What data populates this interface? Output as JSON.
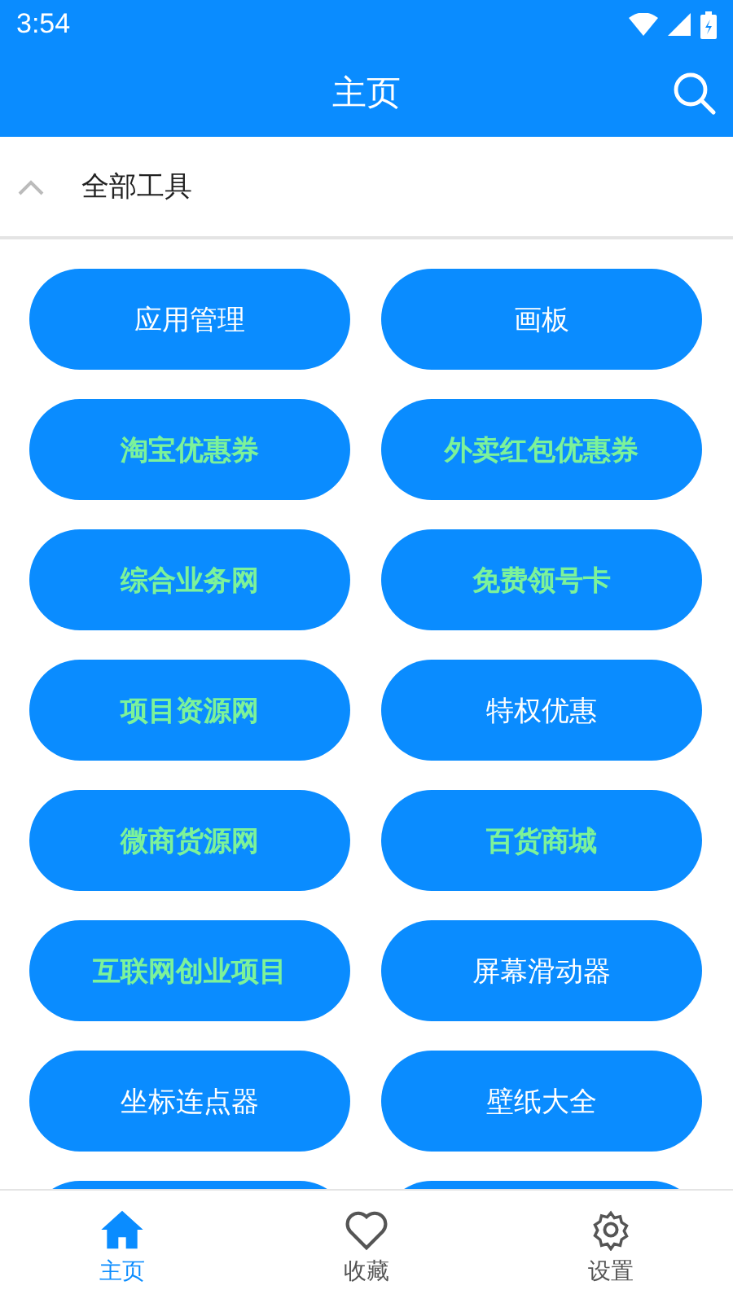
{
  "status_bar": {
    "time": "3:54"
  },
  "app_bar": {
    "title": "主页"
  },
  "section": {
    "title": "全部工具",
    "expanded": true
  },
  "tools": [
    {
      "label": "应用管理",
      "highlighted": false
    },
    {
      "label": "画板",
      "highlighted": false
    },
    {
      "label": "淘宝优惠券",
      "highlighted": true
    },
    {
      "label": "外卖红包优惠券",
      "highlighted": true
    },
    {
      "label": "综合业务网",
      "highlighted": true
    },
    {
      "label": "免费领号卡",
      "highlighted": true
    },
    {
      "label": "项目资源网",
      "highlighted": true
    },
    {
      "label": "特权优惠",
      "highlighted": false
    },
    {
      "label": "微商货源网",
      "highlighted": true
    },
    {
      "label": "百货商城",
      "highlighted": true
    },
    {
      "label": "互联网创业项目",
      "highlighted": true
    },
    {
      "label": "屏幕滑动器",
      "highlighted": false
    },
    {
      "label": "坐标连点器",
      "highlighted": false
    },
    {
      "label": "壁纸大全",
      "highlighted": false
    }
  ],
  "bottom_nav": [
    {
      "kind": "home",
      "label": "主页",
      "selected": true
    },
    {
      "kind": "favorites",
      "label": "收藏",
      "selected": false
    },
    {
      "kind": "settings",
      "label": "设置",
      "selected": false
    }
  ]
}
